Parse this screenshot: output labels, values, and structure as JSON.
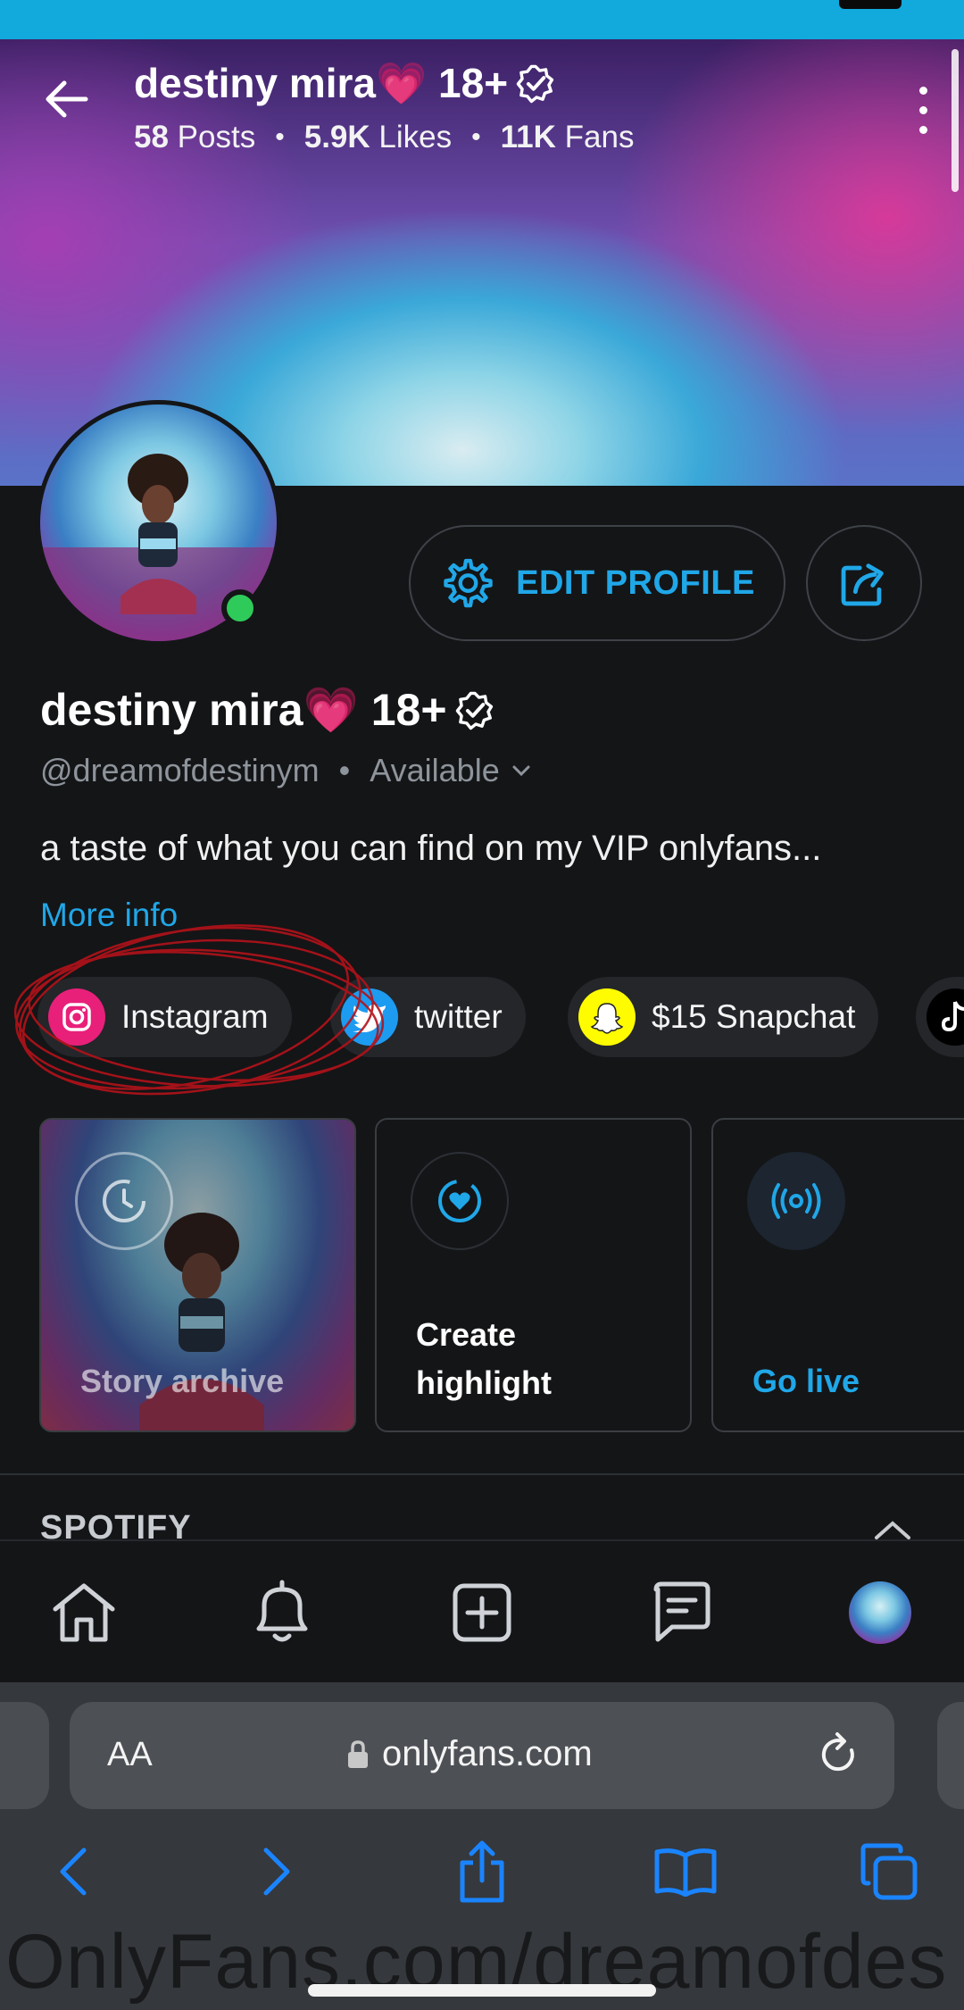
{
  "header": {
    "name": "destiny mira💗 18+",
    "stats": [
      {
        "value": "58",
        "label": "Posts"
      },
      {
        "value": "5.9K",
        "label": "Likes"
      },
      {
        "value": "11K",
        "label": "Fans"
      }
    ]
  },
  "profile": {
    "name": "destiny mira💗 18+",
    "handle": "@dreamofdestinym",
    "status": "Available",
    "bio": "a taste of what you can find on my VIP onlyfans...",
    "more_info": "More info",
    "edit_label": "EDIT PROFILE"
  },
  "social_links": [
    {
      "label": "Instagram",
      "icon": "instagram-icon",
      "color": "#e8207a"
    },
    {
      "label": "twitter",
      "icon": "twitter-icon",
      "color": "#1d9bf0"
    },
    {
      "label": "$15 Snapchat",
      "icon": "snapchat-icon",
      "color": "#fffc00"
    },
    {
      "label": "",
      "icon": "tiktok-icon",
      "color": "#000000"
    }
  ],
  "cards": [
    {
      "label": "Story archive",
      "icon": "clock-icon"
    },
    {
      "label": "Create highlight",
      "icon": "heart-circle-icon"
    },
    {
      "label": "Go live",
      "icon": "broadcast-icon"
    }
  ],
  "section": {
    "title": "SPOTIFY"
  },
  "nav": [
    "home-icon",
    "bell-icon",
    "plus-square-icon",
    "message-icon",
    "profile-avatar"
  ],
  "browser": {
    "aa": "AA",
    "url": "onlyfans.com"
  },
  "watermark": "OnlyFans.com/dreamofdes",
  "colors": {
    "accent": "#20a7e8",
    "background": "#141517",
    "online": "#2ecb5a",
    "annotation": "#b3121a"
  }
}
